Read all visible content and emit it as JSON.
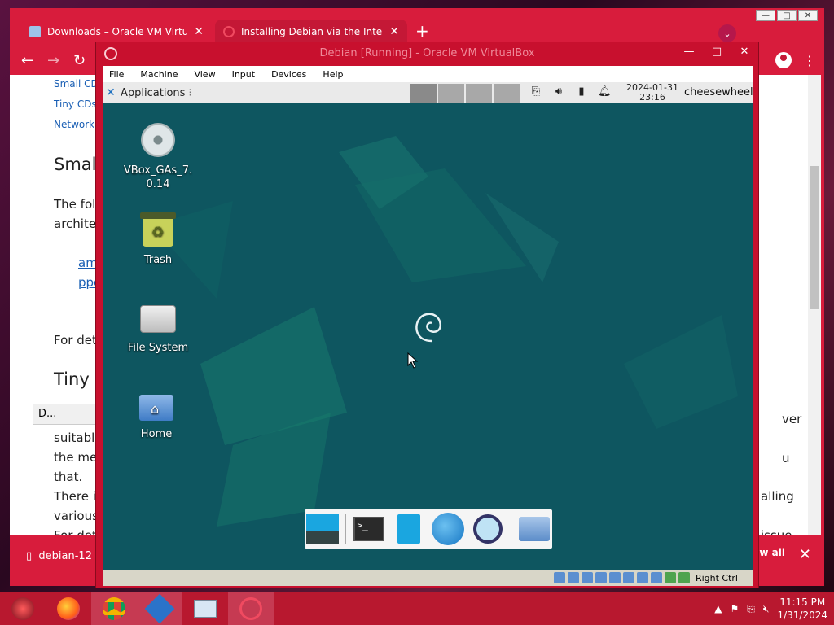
{
  "browser": {
    "tabs": [
      {
        "title": "Downloads – Oracle VM VirtualB",
        "close": "✕"
      },
      {
        "title": "Installing Debian via the Internet",
        "close": "✕"
      }
    ],
    "new_tab": "+",
    "window_controls": {
      "minimize": "—",
      "maximize": "□",
      "close": "✕"
    },
    "toolbar": {
      "back": "←",
      "forward": "→",
      "reload": "↻",
      "menu": "⋮"
    },
    "page": {
      "links": [
        "Small CD",
        "Tiny CDs,",
        "Network b"
      ],
      "heading1": "Smal",
      "para1_line1": "The foll",
      "para1_line2": "architec",
      "big_link1": "am",
      "big_link2": "ppc",
      "for_det": "For det",
      "heading2": "Tiny C",
      "popup_label": "D...",
      "suitable": "suitable",
      "the_med": "the med",
      "that": "that.",
      "there_i": "There i",
      "various": "various",
      "for_det2": "For det",
      "right_ver": "ver",
      "right_u": "u",
      "right_alling": "alling",
      "right_issue": "issue"
    },
    "download": {
      "file": "debian-12",
      "show_all": "w all",
      "close": "✕"
    }
  },
  "vbox": {
    "title": "Debian [Running] - Oracle VM VirtualBox",
    "controls": {
      "minimize": "—",
      "maximize": "□",
      "close": "✕"
    },
    "menu": [
      "File",
      "Machine",
      "View",
      "Input",
      "Devices",
      "Help"
    ],
    "status_label": "Right Ctrl"
  },
  "guest": {
    "panel": {
      "applications": "Applications",
      "clock_date": "2024-01-31",
      "clock_time": "23:16",
      "user": "cheesewheel"
    },
    "desktop_icons": [
      {
        "label_line1": "VBox_GAs_7.",
        "label_line2": "0.14"
      },
      {
        "label_line1": "Trash"
      },
      {
        "label_line1": "File System"
      },
      {
        "label_line1": "Home"
      }
    ],
    "terminal_prompt": ">_"
  },
  "taskbar": {
    "time": "11:15 PM",
    "date": "1/31/2024"
  },
  "colors": {
    "chrome_red": "#d81c3c",
    "vbox_red": "#c8102e",
    "guest_teal": "#0e5660",
    "taskbar": "#b8182f"
  }
}
